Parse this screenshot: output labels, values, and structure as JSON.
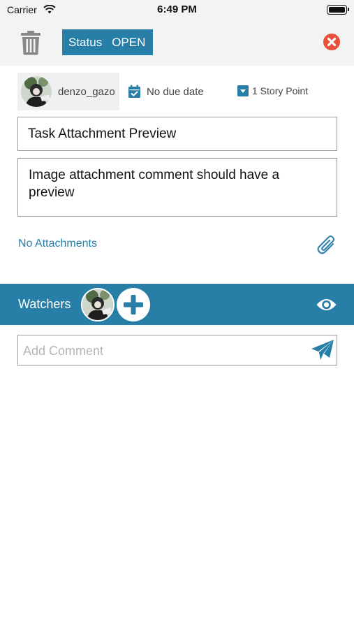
{
  "status_bar": {
    "carrier": "Carrier",
    "time": "6:49 PM"
  },
  "toolbar": {
    "status_label": "Status",
    "status_value": "OPEN"
  },
  "meta": {
    "username": "denzo_gazo",
    "due_date": "No due date",
    "story_points": "1 Story Point"
  },
  "task": {
    "title": "Task Attachment Preview",
    "description": "Image attachment comment should have a preview"
  },
  "attachments": {
    "label": "No Attachments"
  },
  "watchers": {
    "label": "Watchers"
  },
  "comment": {
    "placeholder": "Add Comment"
  },
  "colors": {
    "accent": "#277fa8",
    "close": "#e8503a",
    "bar_bg": "#f3f3f3",
    "icon_gray": "#888888"
  },
  "icons": [
    "trash-icon",
    "close-icon",
    "calendar-icon",
    "dropdown-icon",
    "paperclip-icon",
    "plus-icon",
    "eye-icon",
    "send-icon"
  ]
}
